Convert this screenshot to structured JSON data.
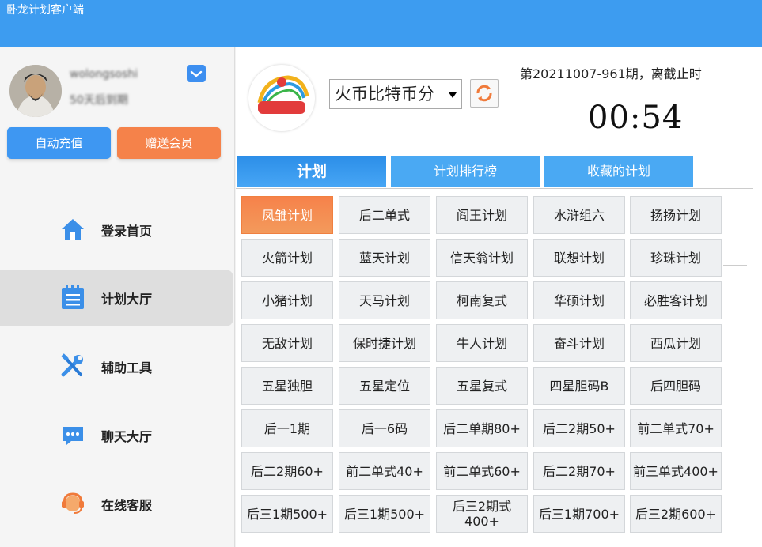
{
  "window": {
    "title": "卧龙计划客户端"
  },
  "user": {
    "name": "wolongsoshi",
    "expire": "50天后到期"
  },
  "buttons": {
    "charge": "自动充值",
    "gift": "赠送会员"
  },
  "nav": [
    {
      "label": "登录首页",
      "icon": "home-icon"
    },
    {
      "label": "计划大厅",
      "icon": "list-icon"
    },
    {
      "label": "辅助工具",
      "icon": "tools-icon"
    },
    {
      "label": "聊天大厅",
      "icon": "chat-icon"
    },
    {
      "label": "在线客服",
      "icon": "headset-icon"
    }
  ],
  "lottery": {
    "selected": "火币比特币分"
  },
  "period": {
    "text": "第20211007-961期，离截止时",
    "countdown": "00:54"
  },
  "tabs": [
    "计划",
    "计划排行榜",
    "收藏的计划"
  ],
  "plans": [
    [
      "凤雏计划",
      "后二单式",
      "阎王计划",
      "水浒组六",
      "扬扬计划"
    ],
    [
      "火箭计划",
      "蓝天计划",
      "信天翁计划",
      "联想计划",
      "珍珠计划"
    ],
    [
      "小猪计划",
      "天马计划",
      "柯南复式",
      "华硕计划",
      "必胜客计划"
    ],
    [
      "无敌计划",
      "保时捷计划",
      "牛人计划",
      "奋斗计划",
      "西瓜计划"
    ],
    [
      "五星独胆",
      "五星定位",
      "五星复式",
      "四星胆码B",
      "后四胆码"
    ],
    [
      "后一1期",
      "后一6码",
      "后二单期80+",
      "后二2期50+",
      "前二单式70+"
    ],
    [
      "后二2期60+",
      "前二单式40+",
      "前二单式60+",
      "后二2期70+",
      "前三单式400+"
    ],
    [
      "后三1期500+",
      "后三1期500+",
      "后三2期式400+",
      "后三1期700+",
      "后三2期600+"
    ]
  ],
  "active_plan": "凤雏计划",
  "colors": {
    "titlebar": "#3d9cf0",
    "accent_orange": "#f5824a",
    "tab_blue": "#4aa9f3"
  }
}
